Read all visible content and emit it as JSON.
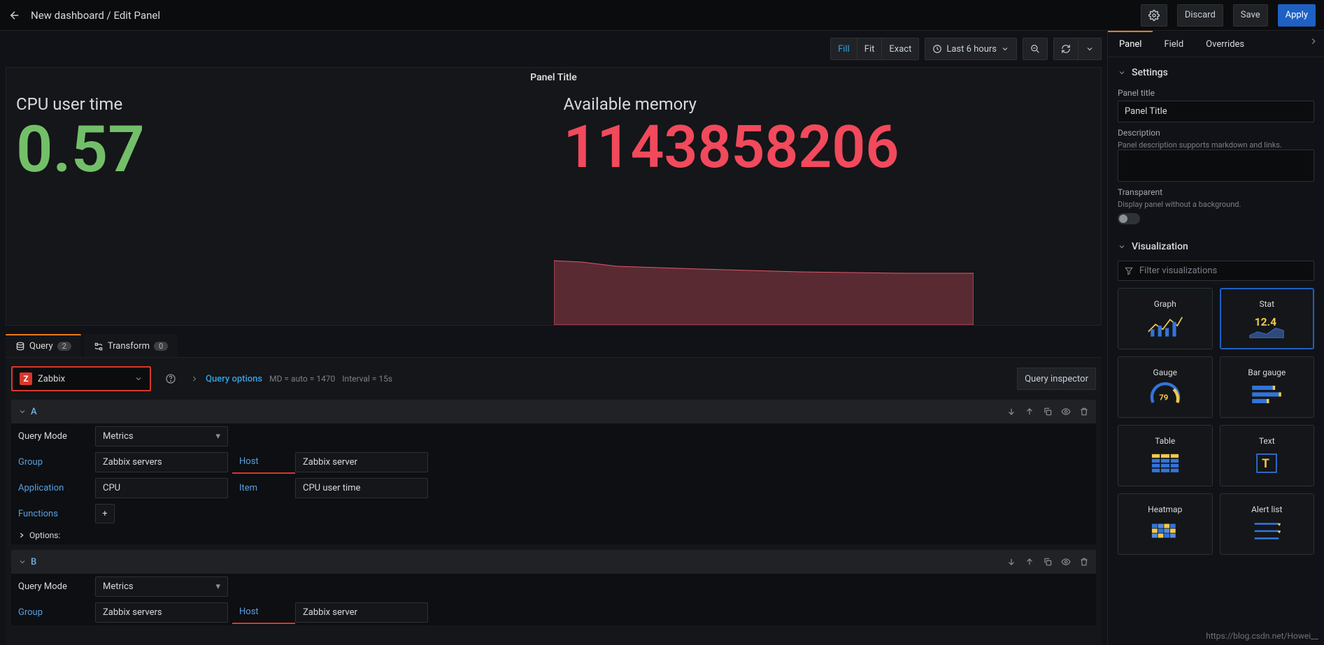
{
  "topbar": {
    "breadcrumb": "New dashboard / Edit Panel",
    "discard": "Discard",
    "save": "Save",
    "apply": "Apply"
  },
  "toolbar": {
    "fill": "Fill",
    "fit": "Fit",
    "exact": "Exact",
    "timerange": "Last 6 hours"
  },
  "panel": {
    "title": "Panel Title",
    "statA": {
      "label": "CPU user time",
      "value": "0.57"
    },
    "statB": {
      "label": "Available memory",
      "value": "1143858206"
    }
  },
  "editorTabs": {
    "query": "Query",
    "queryCount": "2",
    "transform": "Transform",
    "transformCount": "0"
  },
  "datasource": {
    "name": "Zabbix",
    "logo": "Z"
  },
  "queryOptions": {
    "label": "Query options",
    "md": "MD = auto = 1470",
    "interval": "Interval = 15s",
    "inspector": "Query inspector"
  },
  "queries": [
    {
      "id": "A",
      "mode_label": "Query Mode",
      "mode": "Metrics",
      "group_label": "Group",
      "group": "Zabbix servers",
      "host_label": "Host",
      "host": "Zabbix server",
      "app_label": "Application",
      "app": "CPU",
      "item_label": "Item",
      "item": "CPU user time",
      "functions_label": "Functions",
      "options_label": "Options:"
    },
    {
      "id": "B",
      "mode_label": "Query Mode",
      "mode": "Metrics",
      "group_label": "Group",
      "group": "Zabbix servers",
      "host_label": "Host",
      "host": "Zabbix server"
    }
  ],
  "side": {
    "tabs": {
      "panel": "Panel",
      "field": "Field",
      "overrides": "Overrides"
    },
    "settings": {
      "heading": "Settings",
      "title_label": "Panel title",
      "title_value": "Panel Title",
      "desc_label": "Description",
      "desc_hint": "Panel description supports markdown and links.",
      "transparent_label": "Transparent",
      "transparent_hint": "Display panel without a background."
    },
    "viz": {
      "heading": "Visualization",
      "filter_placeholder": "Filter visualizations",
      "cards": [
        "Graph",
        "Stat",
        "Gauge",
        "Bar gauge",
        "Table",
        "Text",
        "Heatmap",
        "Alert list"
      ],
      "stat_value": "12.4",
      "gauge_value": "79"
    }
  },
  "watermark": "https://blog.csdn.net/Howei__"
}
